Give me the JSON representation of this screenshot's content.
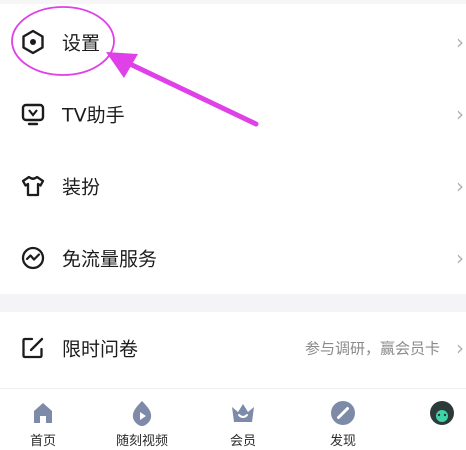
{
  "menu": {
    "items": [
      {
        "label": "设置",
        "icon": "settings-hexagon-icon"
      },
      {
        "label": "TV助手",
        "icon": "tv-icon"
      },
      {
        "label": "装扮",
        "icon": "tshirt-icon"
      },
      {
        "label": "免流量服务",
        "icon": "data-wave-icon"
      }
    ],
    "survey": {
      "label": "限时问卷",
      "sub": "参与调研，赢会员卡",
      "icon": "edit-icon"
    }
  },
  "tabbar": {
    "tabs": [
      {
        "label": "首页",
        "icon": "home-icon"
      },
      {
        "label": "随刻视频",
        "icon": "fire-play-icon"
      },
      {
        "label": "会员",
        "icon": "crown-icon"
      },
      {
        "label": "发现",
        "icon": "compass-icon"
      }
    ]
  },
  "colors": {
    "highlight": "#e040e8",
    "text": "#1c1c1c",
    "sub_text": "#8a8a8a",
    "tab_icon": "#7d8aa8"
  }
}
